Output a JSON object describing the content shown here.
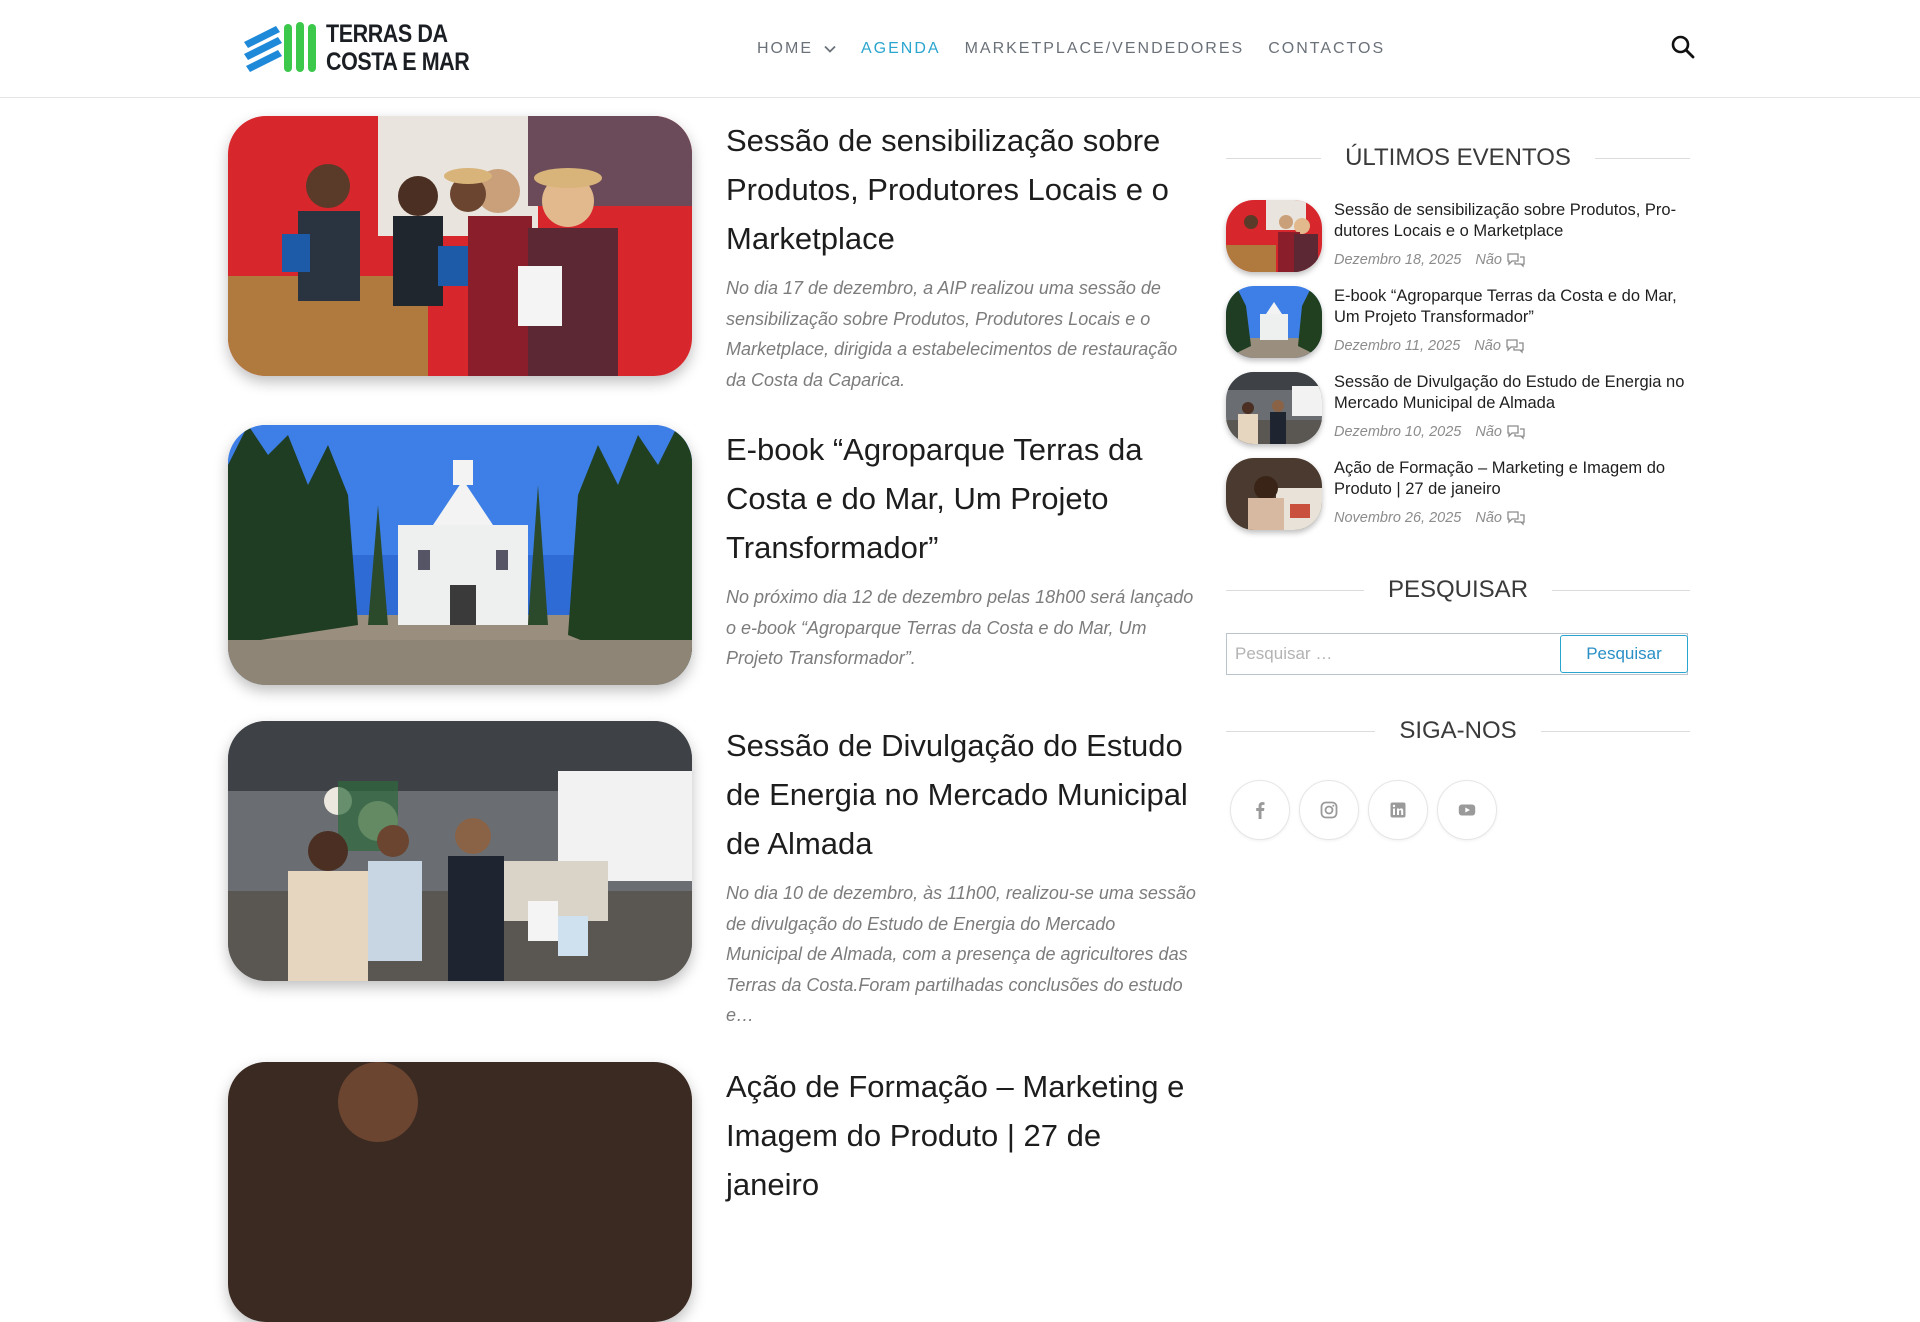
{
  "brand": {
    "line1": "TERRAS DA",
    "line2": "COSTA E MAR"
  },
  "nav": {
    "items": [
      {
        "label": "HOME"
      },
      {
        "label": "AGENDA"
      },
      {
        "label": "MARKETPLACE/VENDEDORES"
      },
      {
        "label": "CONTACTOS"
      }
    ],
    "active": "AGENDA"
  },
  "posts": [
    {
      "title": "Sessão de sensibilização sobre Produtos, Produtores Locais e o Marketplace",
      "excerpt": "No dia 17 de dezembro, a AIP realizou uma sessão de sensibilização sobre Produtos, Produtores Locais e o Marketplace, dirigida a estabelecimentos de restauração da Costa da Caparica."
    },
    {
      "title": "E-book “Agroparque Terras da Costa e do Mar, Um Projeto Transformador”",
      "excerpt": "No próximo dia 12 de dezembro pelas 18h00 será lançado o e-book “Agroparque Terras da Costa e do Mar, Um Projeto Transformador”."
    },
    {
      "title": "Sessão de Divulgação do Estudo de Energia no Mercado Municipal de Almada",
      "excerpt": "No dia 10 de dezembro, às 11h00, realizou-se uma sessão de divulgação do Estudo de Energia do Mercado Municipal de Almada, com a presença de agricultores das Terras da Costa.Foram partilhadas conclusões do estudo e…"
    },
    {
      "title": "Ação de Formação – Marketing e Imagem do Produto | 27 de janeiro",
      "excerpt": ""
    }
  ],
  "sidebar": {
    "latest_title": "ÚLTIMOS EVENTOS",
    "events": [
      {
        "title": "Sessão de sensibilização sobre Produtos, Pro-dutores Locais e o Marketplace",
        "date": "Dezembro 18, 2025",
        "comments": "Não"
      },
      {
        "title": "E-book “Agroparque Terras da Costa e do Mar, Um Projeto Transformador”",
        "date": "Dezembro 11, 2025",
        "comments": "Não"
      },
      {
        "title": "Sessão de Divulgação do Estudo de Energia no Mercado Municipal de Almada",
        "date": "Dezembro 10, 2025",
        "comments": "Não"
      },
      {
        "title": "Ação de Formação – Marketing e Imagem do Produto | 27 de janeiro",
        "date": "Novembro 26, 2025",
        "comments": "Não"
      }
    ],
    "search_title": "PESQUISAR",
    "search_placeholder": "Pesquisar …",
    "search_button": "Pesquisar",
    "follow_title": "SIGA-NOS",
    "social_icons": [
      "facebook-icon",
      "instagram-icon",
      "linkedin-icon",
      "youtube-icon"
    ]
  },
  "colors": {
    "accent": "#2aa5cf",
    "text": "#1d1d1d",
    "muted": "#7c7c7c"
  }
}
